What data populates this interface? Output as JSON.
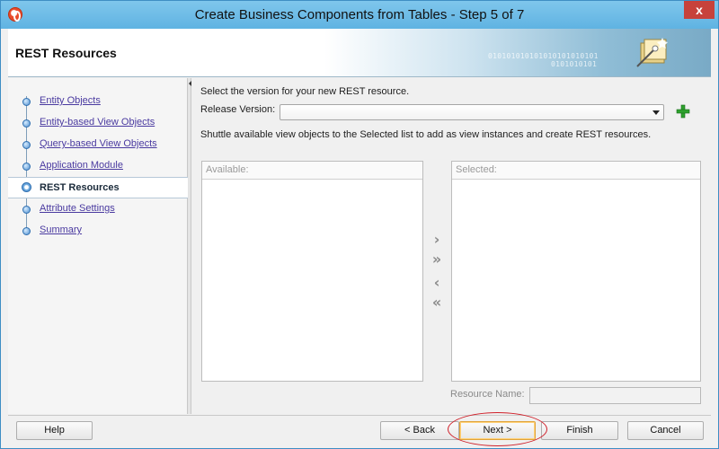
{
  "window": {
    "title": "Create Business Components from Tables - Step 5 of 7",
    "close_glyph": "x"
  },
  "header": {
    "title": "REST Resources",
    "binary_line1": "010101010101010101010101",
    "binary_line2": "0101010101"
  },
  "nav": {
    "items": [
      {
        "label": "Entity Objects",
        "active": false
      },
      {
        "label": "Entity-based View Objects",
        "active": false
      },
      {
        "label": "Query-based View Objects",
        "active": false
      },
      {
        "label": "Application Module",
        "active": false
      },
      {
        "label": "REST Resources",
        "active": true
      },
      {
        "label": "Attribute Settings",
        "active": false
      },
      {
        "label": "Summary",
        "active": false
      }
    ]
  },
  "main": {
    "intro": "Select the version for your new REST resource.",
    "release_label": "Release Version:",
    "release_value": "",
    "add_icon": "plus-icon",
    "shuttle_text": "Shuttle available view objects to the Selected list  to add as view instances and create REST resources.",
    "available_header": "Available:",
    "selected_header": "Selected:",
    "move_one": "›",
    "move_all": "»",
    "remove_one": "‹",
    "remove_all": "«",
    "resource_name_label": "Resource Name:",
    "resource_name_value": ""
  },
  "footer": {
    "help": "Help",
    "back": "< Back",
    "next": "Next >",
    "finish": "Finish",
    "cancel": "Cancel"
  },
  "colors": {
    "accent_green": "#2ea12e",
    "highlight_red": "#d0202a",
    "title_bar": "#6bb8e0"
  }
}
